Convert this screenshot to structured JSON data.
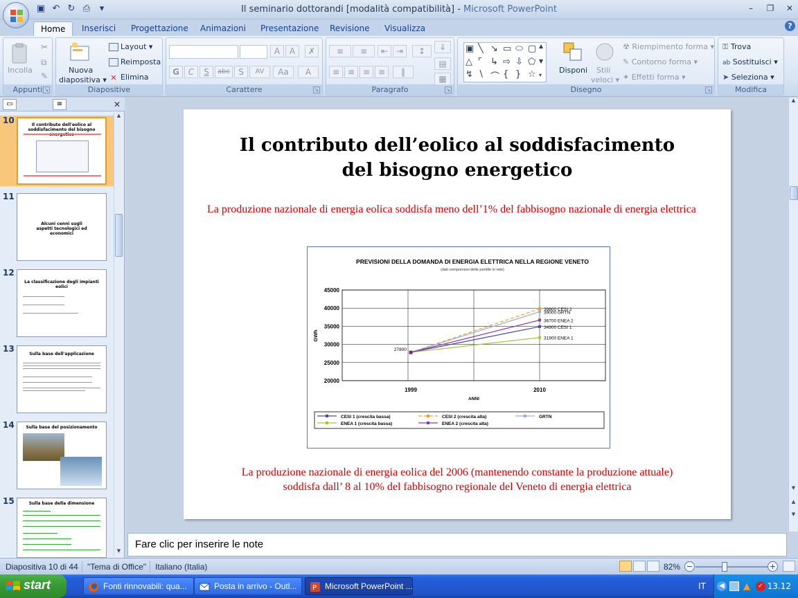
{
  "window": {
    "title": "Il seminario dottorandi [modalità compatibilità]",
    "title_sep": " - ",
    "app_name": "Microsoft PowerPoint"
  },
  "ribbon_tabs": [
    "Home",
    "Inserisci",
    "Progettazione",
    "Animazioni",
    "Presentazione",
    "Revisione",
    "Visualizza"
  ],
  "ribbon": {
    "appunti": {
      "label": "Appunti",
      "paste": "Incolla"
    },
    "diapositive": {
      "label": "Diapositive",
      "new_slide_1": "Nuova",
      "new_slide_2": "diapositiva",
      "layout": "Layout",
      "reset": "Reimposta",
      "delete": "Elimina"
    },
    "carattere": {
      "label": "Carattere",
      "bold": "G",
      "italic": "C",
      "underline": "S",
      "strike": "abc",
      "shadow": "S",
      "spacing": "AV",
      "case": "Aa",
      "color": "A"
    },
    "paragrafo": {
      "label": "Paragrafo"
    },
    "disegno": {
      "label": "Disegno",
      "arrange": "Disponi",
      "styles_1": "Stili",
      "styles_2": "veloci",
      "fill": "Riempimento forma",
      "outline": "Contorno forma",
      "effects": "Effetti forma"
    },
    "modifica": {
      "label": "Modifica",
      "find": "Trova",
      "replace": "Sostituisci",
      "select": "Seleziona"
    }
  },
  "thumbnails": [
    {
      "num": "10",
      "title": "Il contributo dell'eolico al soddisfacimento del bisogno energetico"
    },
    {
      "num": "11",
      "title": "Alcuni cenni sugli aspetti tecnologici ed economici"
    },
    {
      "num": "12",
      "title": "La classificazione degli impianti eolici"
    },
    {
      "num": "13",
      "title": "Sulla base dell'applicazione"
    },
    {
      "num": "14",
      "title": "Sulla base del posizionamento"
    },
    {
      "num": "15",
      "title": "Sulla base della dimensione"
    }
  ],
  "slide": {
    "title_line1": "Il contributo dell’eolico al soddisfacimento",
    "title_line2": "del bisogno energetico",
    "text_top": "La produzione nazionale di energia eolica soddisfa meno dell’1%  del fabbisogno nazionale di energia elettrica",
    "text_bottom_line1": "La produzione nazionale di energia eolica del 2006 (mantenendo constante la produzione attuale)",
    "text_bottom_line2": "soddisfa dall’ 8 al 10%  del fabbisogno regionale del Veneto di energia elettrica"
  },
  "chart_data": {
    "type": "line",
    "title": "PREVISIONI  DELLA DOMANDA DI ENERGIA ELETTRICA NELLA REGIONE VENETO",
    "subtitle": "(dati comprensivi delle perdite in rete)",
    "xlabel": "ANNI",
    "ylabel": "GWh",
    "x": [
      "1999",
      "2010"
    ],
    "ylim": [
      20000,
      45000
    ],
    "yticks": [
      20000,
      25000,
      30000,
      35000,
      40000,
      45000
    ],
    "start_label": "27800",
    "series": [
      {
        "name": "CESI 1 (crescita bassa)",
        "short": "CESI 1",
        "values": [
          27800,
          34900
        ],
        "color": "#4a4aa0",
        "dash": ""
      },
      {
        "name": "CESI 2 (crescita alta)",
        "short": "CESI 2",
        "values": [
          27800,
          39800
        ],
        "color": "#f0a020",
        "dash": "5,3"
      },
      {
        "name": "GRTN",
        "short": "GRTN",
        "values": [
          27800,
          39000
        ],
        "color": "#99aadd",
        "dash": ""
      },
      {
        "name": "ENEA 1 (crescita bassa)",
        "short": "ENEA 1",
        "values": [
          27800,
          31900
        ],
        "color": "#a8c83a",
        "dash": ""
      },
      {
        "name": "ENEA 2 (crescita alta)",
        "short": "ENEA 2",
        "values": [
          27800,
          36700
        ],
        "color": "#8a3aa8",
        "dash": ""
      }
    ],
    "grid": true,
    "legend_position": "bottom"
  },
  "notes": {
    "placeholder": "Fare clic per inserire le note"
  },
  "status": {
    "slide_counter": "Diapositiva 10 di 44",
    "theme": "\"Tema di Office\"",
    "language": "Italiano (Italia)",
    "zoom": "82%"
  },
  "taskbar": {
    "start": "start",
    "tasks": [
      "Fonti rinnovabili: qua...",
      "Posta in arrivo - Outl...",
      "Microsoft PowerPoint ..."
    ],
    "lang": "IT",
    "clock": "13.12"
  }
}
